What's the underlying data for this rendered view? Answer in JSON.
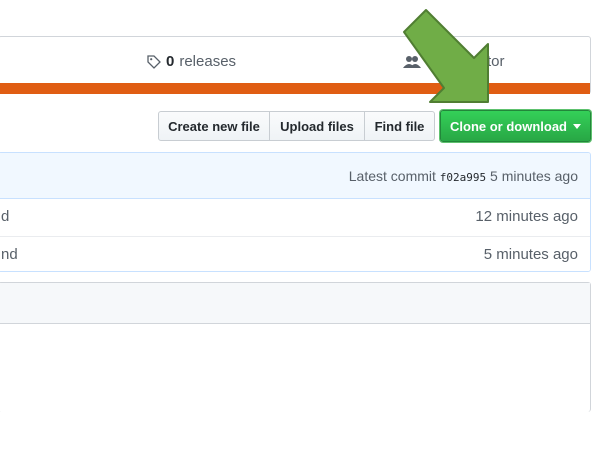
{
  "summary": {
    "releases_count": "0",
    "releases_label": "releases",
    "contributors_label": "ributor"
  },
  "colors": {
    "language_bar": "#e05d13",
    "clone_button": "#28a745",
    "arrow": "#70ad47"
  },
  "toolbar": {
    "create_new_file": "Create new file",
    "upload_files": "Upload files",
    "find_file": "Find file",
    "clone_or_download": "Clone or download"
  },
  "commit": {
    "prefix": "Latest commit",
    "sha": "f02a995",
    "time": "5 minutes ago"
  },
  "files": [
    {
      "message": "d",
      "age": "12 minutes ago"
    },
    {
      "message": "nd",
      "age": "5 minutes ago"
    }
  ],
  "icons": {
    "releases": "tag-icon",
    "contributors": "people-icon",
    "dropdown": "caret-down-icon",
    "annotation": "arrow-annotation"
  }
}
